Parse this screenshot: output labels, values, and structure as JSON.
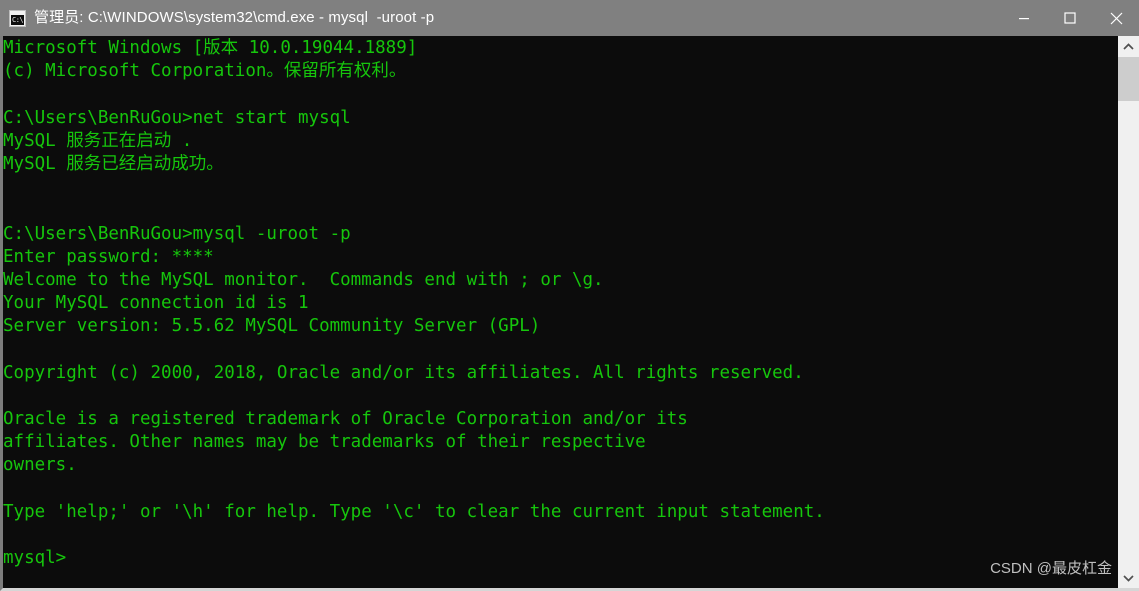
{
  "window": {
    "title": "管理员: C:\\WINDOWS\\system32\\cmd.exe - mysql  -uroot -p",
    "icon_name": "cmd-console-icon",
    "icon_text": "C:\\.",
    "background_color": "#0c0c0c",
    "titlebar_color": "#808080",
    "text_color": "#16c60c"
  },
  "controls": {
    "minimize_label": "最小化",
    "maximize_label": "最大化",
    "close_label": "关闭"
  },
  "scrollbar": {
    "up_arrow": "▲",
    "down_arrow": "▼"
  },
  "console": {
    "lines": [
      "Microsoft Windows [版本 10.0.19044.1889]",
      "(c) Microsoft Corporation。保留所有权利。",
      "",
      "C:\\Users\\BenRuGou>net start mysql",
      "MySQL 服务正在启动 .",
      "MySQL 服务已经启动成功。",
      "",
      "",
      "C:\\Users\\BenRuGou>mysql -uroot -p",
      "Enter password: ****",
      "Welcome to the MySQL monitor.  Commands end with ; or \\g.",
      "Your MySQL connection id is 1",
      "Server version: 5.5.62 MySQL Community Server (GPL)",
      "",
      "Copyright (c) 2000, 2018, Oracle and/or its affiliates. All rights reserved.",
      "",
      "Oracle is a registered trademark of Oracle Corporation and/or its",
      "affiliates. Other names may be trademarks of their respective",
      "owners.",
      "",
      "Type 'help;' or '\\h' for help. Type '\\c' to clear the current input statement.",
      "",
      "mysql>"
    ]
  },
  "watermark": {
    "text": "CSDN @最皮杠金"
  }
}
